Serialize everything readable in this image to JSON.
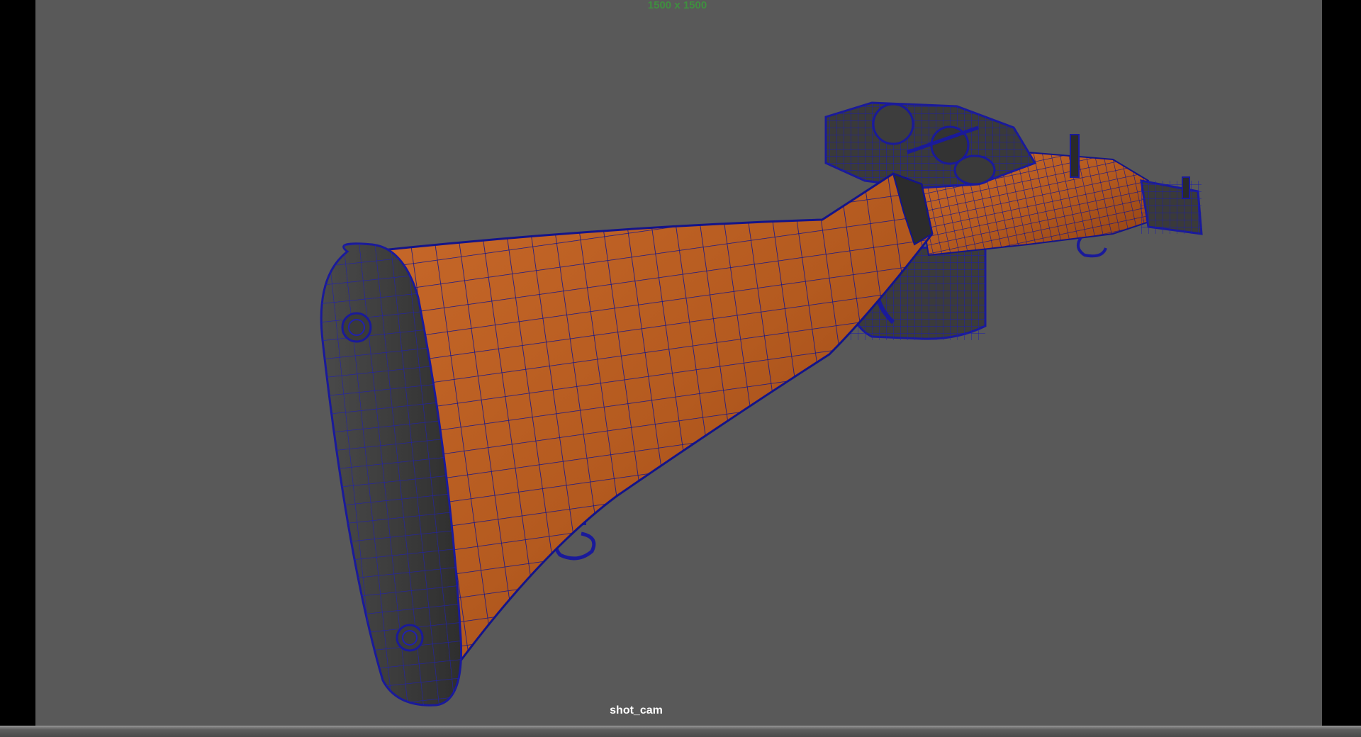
{
  "viewport": {
    "resolution_gate": "1500 x 1500",
    "camera_name": "shot_cam",
    "background_color": "#595959",
    "wireframe_color": "#0a0a8c",
    "wood_color": "#b85a1e"
  },
  "scene": {
    "object": "rifle-model",
    "display_mode": "textured-with-wireframe"
  }
}
